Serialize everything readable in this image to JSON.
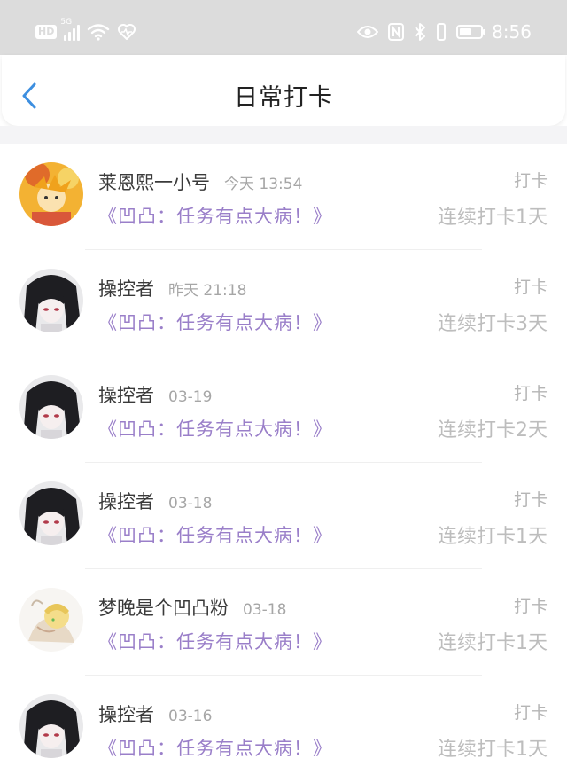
{
  "status_bar": {
    "hd_badge": "HD",
    "network": "5G",
    "time": "8:56",
    "battery_level": 0.6
  },
  "header": {
    "title": "日常打卡"
  },
  "entries": [
    {
      "user": "莱恩熙一小号",
      "time": "今天 13:54",
      "task": "《凹凸：任务有点大病！》",
      "action": "打卡",
      "streak": "连续打卡1天",
      "avatar": "avatar-yellow"
    },
    {
      "user": "操控者",
      "time": "昨天 21:18",
      "task": "《凹凸：任务有点大病！》",
      "action": "打卡",
      "streak": "连续打卡3天",
      "avatar": "avatar-dark"
    },
    {
      "user": "操控者",
      "time": "03-19",
      "task": "《凹凸：任务有点大病！》",
      "action": "打卡",
      "streak": "连续打卡2天",
      "avatar": "avatar-dark"
    },
    {
      "user": "操控者",
      "time": "03-18",
      "task": "《凹凸：任务有点大病！》",
      "action": "打卡",
      "streak": "连续打卡1天",
      "avatar": "avatar-dark"
    },
    {
      "user": "梦晚是个凹凸粉",
      "time": "03-18",
      "task": "《凹凸：任务有点大病！》",
      "action": "打卡",
      "streak": "连续打卡1天",
      "avatar": "avatar-light"
    },
    {
      "user": "操控者",
      "time": "03-16",
      "task": "《凹凸：任务有点大病！》",
      "action": "打卡",
      "streak": "连续打卡1天",
      "avatar": "avatar-dark"
    }
  ],
  "colors": {
    "status_bar_bg": "#dcdcdc",
    "back_arrow": "#3d8fe0",
    "task_text": "#9a7fc9",
    "muted_text": "#bdbdbd"
  }
}
